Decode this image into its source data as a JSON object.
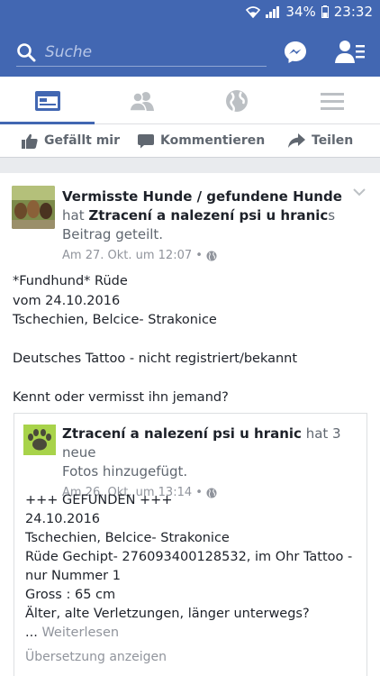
{
  "statusbar": {
    "battery": "34%",
    "time": "23:32"
  },
  "search": {
    "placeholder": "Suche"
  },
  "actions": {
    "like": "Gefällt mir",
    "comment": "Kommentieren",
    "share": "Teilen"
  },
  "post": {
    "author": "Vermisste Hunde / gefundene Hunde",
    "shared_word": "hat",
    "shared_page": "Ztracení a nalezení psi u hranic",
    "shared_suffix_1": "s",
    "shared_suffix_2": "Beitrag geteilt.",
    "timestamp": "Am 27. Okt. um 12:07 •",
    "body": [
      "*Fundhund* Rüde",
      "vom 24.10.2016",
      "Tschechien, Belcice- Strakonice",
      "",
      "Deutsches Tattoo - nicht registriert/bekannt",
      "",
      "Kennt oder vermisst ihn jemand?"
    ]
  },
  "shared_post": {
    "author": "Ztracení a nalezení psi u hranic",
    "action_1": "hat 3 neue",
    "action_2": "Fotos hinzugefügt.",
    "timestamp": "Am 26. Okt. um 13:14 •",
    "body": [
      "+++ GEFUNDEN +++",
      "24.10.2016",
      "Tschechien, Belcice- Strakonice",
      "Rüde Gechipt- 276093400128532, im Ohr Tattoo -",
      "nur Nummer 1",
      "Gross : 65 cm",
      "Älter, alte Verletzungen, länger unterwegs?"
    ],
    "ellipsis": "...",
    "see_more": "Weiterlesen",
    "translate": "Übersetzung anzeigen"
  },
  "colors": {
    "brand": "#4267b2",
    "muted": "#90949c",
    "text": "#1d2129"
  }
}
